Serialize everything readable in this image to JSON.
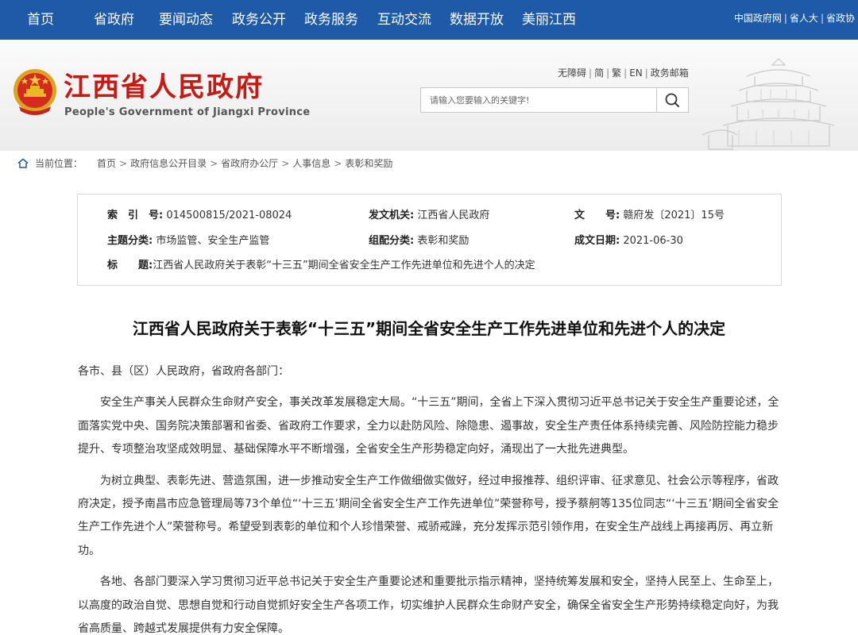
{
  "topnav": {
    "items": [
      "首页",
      "省政府",
      "要闻动态",
      "政务公开",
      "政务服务",
      "互动交流",
      "数据开放",
      "美丽江西"
    ],
    "links": [
      "中国政府网",
      "省人大",
      "省政协"
    ],
    "link_separator": "|"
  },
  "header": {
    "title": "江西省人民政府",
    "subtitle": "People's Government of Jiangxi Province",
    "utility": [
      "无障碍",
      "简",
      "繁",
      "EN",
      "政务邮箱"
    ],
    "utility_separator": "|",
    "search_placeholder": "请输入您要输入的关键字!"
  },
  "breadcrumb": {
    "label": "当前位置：",
    "items": [
      "首页",
      "政府信息公开目录",
      "省政府办公厅",
      "人事信息",
      "表彰和奖励"
    ],
    "separator": ">"
  },
  "info": {
    "index_label": "索　引　号:",
    "index_value": "014500815/2021-08024",
    "issuer_label": "发文机关:",
    "issuer_value": "江西省人民政府",
    "docno_label": "文　　号:",
    "docno_value": "赣府发〔2021〕15号",
    "topic_label": "主题分类:",
    "topic_value": "市场监管、安全生产监管",
    "group_label": "组配分类:",
    "group_value": "表彰和奖励",
    "date_label": "成文日期:",
    "date_value": "2021-06-30",
    "title_label": "标　　题:",
    "title_value": "江西省人民政府关于表彰“十三五”期间全省安全生产工作先进单位和先进个人的决定"
  },
  "article": {
    "title": "江西省人民政府关于表彰“十三五”期间全省安全生产工作先进单位和先进个人的决定",
    "salutation": "各市、县（区）人民政府，省政府各部门：",
    "paragraphs": [
      "安全生产事关人民群众生命财产安全，事关改革发展稳定大局。“十三五”期间，全省上下深入贯彻习近平总书记关于安全生产重要论述，全面落实党中央、国务院决策部署和省委、省政府工作要求，全力以赴防风险、除隐患、遏事故，安全生产责任体系持续完善、风险防控能力稳步提升、专项整治攻坚成效明显、基础保障水平不断增强，全省安全生产形势稳定向好，涌现出了一大批先进典型。",
      "为树立典型、表彰先进、营造氛围，进一步推动安全生产工作做细做实做好，经过申报推荐、组织评审、征求意见、社会公示等程序，省政府决定，授予南昌市应急管理局等73个单位“‘十三五’期间全省安全生产工作先进单位”荣誉称号，授予蔡舸等135位同志“‘十三五’期间全省安全生产工作先进个人”荣誉称号。希望受到表彰的单位和个人珍惜荣誉、戒骄戒躁，充分发挥示范引领作用，在安全生产战线上再接再厉、再立新功。",
      "各地、各部门要深入学习贯彻习近平总书记关于安全生产重要论述和重要批示指示精神，坚持统筹发展和安全，坚持人民至上、生命至上，以高度的政治自觉、思想自觉和行动自觉抓好安全生产各项工作，切实维护人民群众生命财产安全，确保全省安全生产形势持续稳定向好，为我省高质量、跨越式发展提供有力安全保障。"
    ]
  },
  "colors": {
    "nav": "#1e5aa8",
    "title_red": "#c61a13"
  }
}
